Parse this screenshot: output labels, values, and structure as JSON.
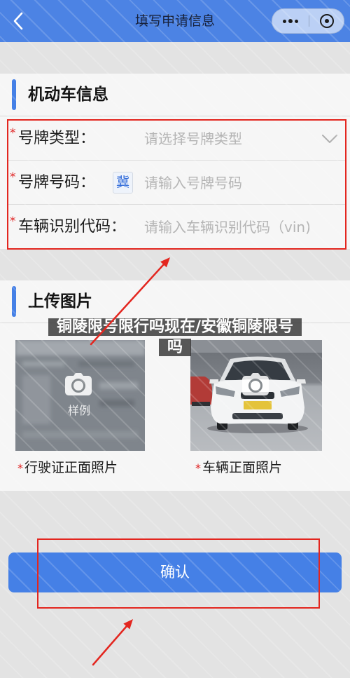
{
  "nav": {
    "title": "填写申请信息",
    "icons": {
      "back": "chevron-left-icon",
      "more": "more-dots-icon",
      "close": "target-circle-icon"
    }
  },
  "vehicle_section": {
    "title": "机动车信息",
    "fields": [
      {
        "required_mark": "*",
        "label": "号牌类型：",
        "placeholder": "请选择号牌类型",
        "icon": "chevron-down-icon"
      },
      {
        "required_mark": "*",
        "label": "号牌号码：",
        "prefix": "冀",
        "placeholder": "请输入号牌号码",
        "value": ""
      },
      {
        "required_mark": "*",
        "label": "车辆识别代码：",
        "placeholder": "请输入车辆识别代码（vin)",
        "value": ""
      }
    ]
  },
  "upload_section": {
    "title": "上传图片",
    "photos": [
      {
        "required_mark": "*",
        "caption": "行驶证正面照片",
        "sample_label": "样例",
        "icon": "camera-icon"
      },
      {
        "required_mark": "*",
        "caption": "车辆正面照片",
        "icon": "camera-icon"
      }
    ]
  },
  "confirm_button": {
    "label": "确认"
  },
  "watermark": {
    "text": "铜陵限号限行吗现在/安徽铜陵限号吗"
  },
  "colors": {
    "nav_bg": "#4c83e4",
    "accent": "#4580e6",
    "required": "#e02424",
    "annotation": "#e3261f",
    "placeholder": "#b4b4b4",
    "page_bg": "#e3e3e3",
    "card_bg": "#f6f6f6",
    "province_text": "#2f6ad9"
  }
}
